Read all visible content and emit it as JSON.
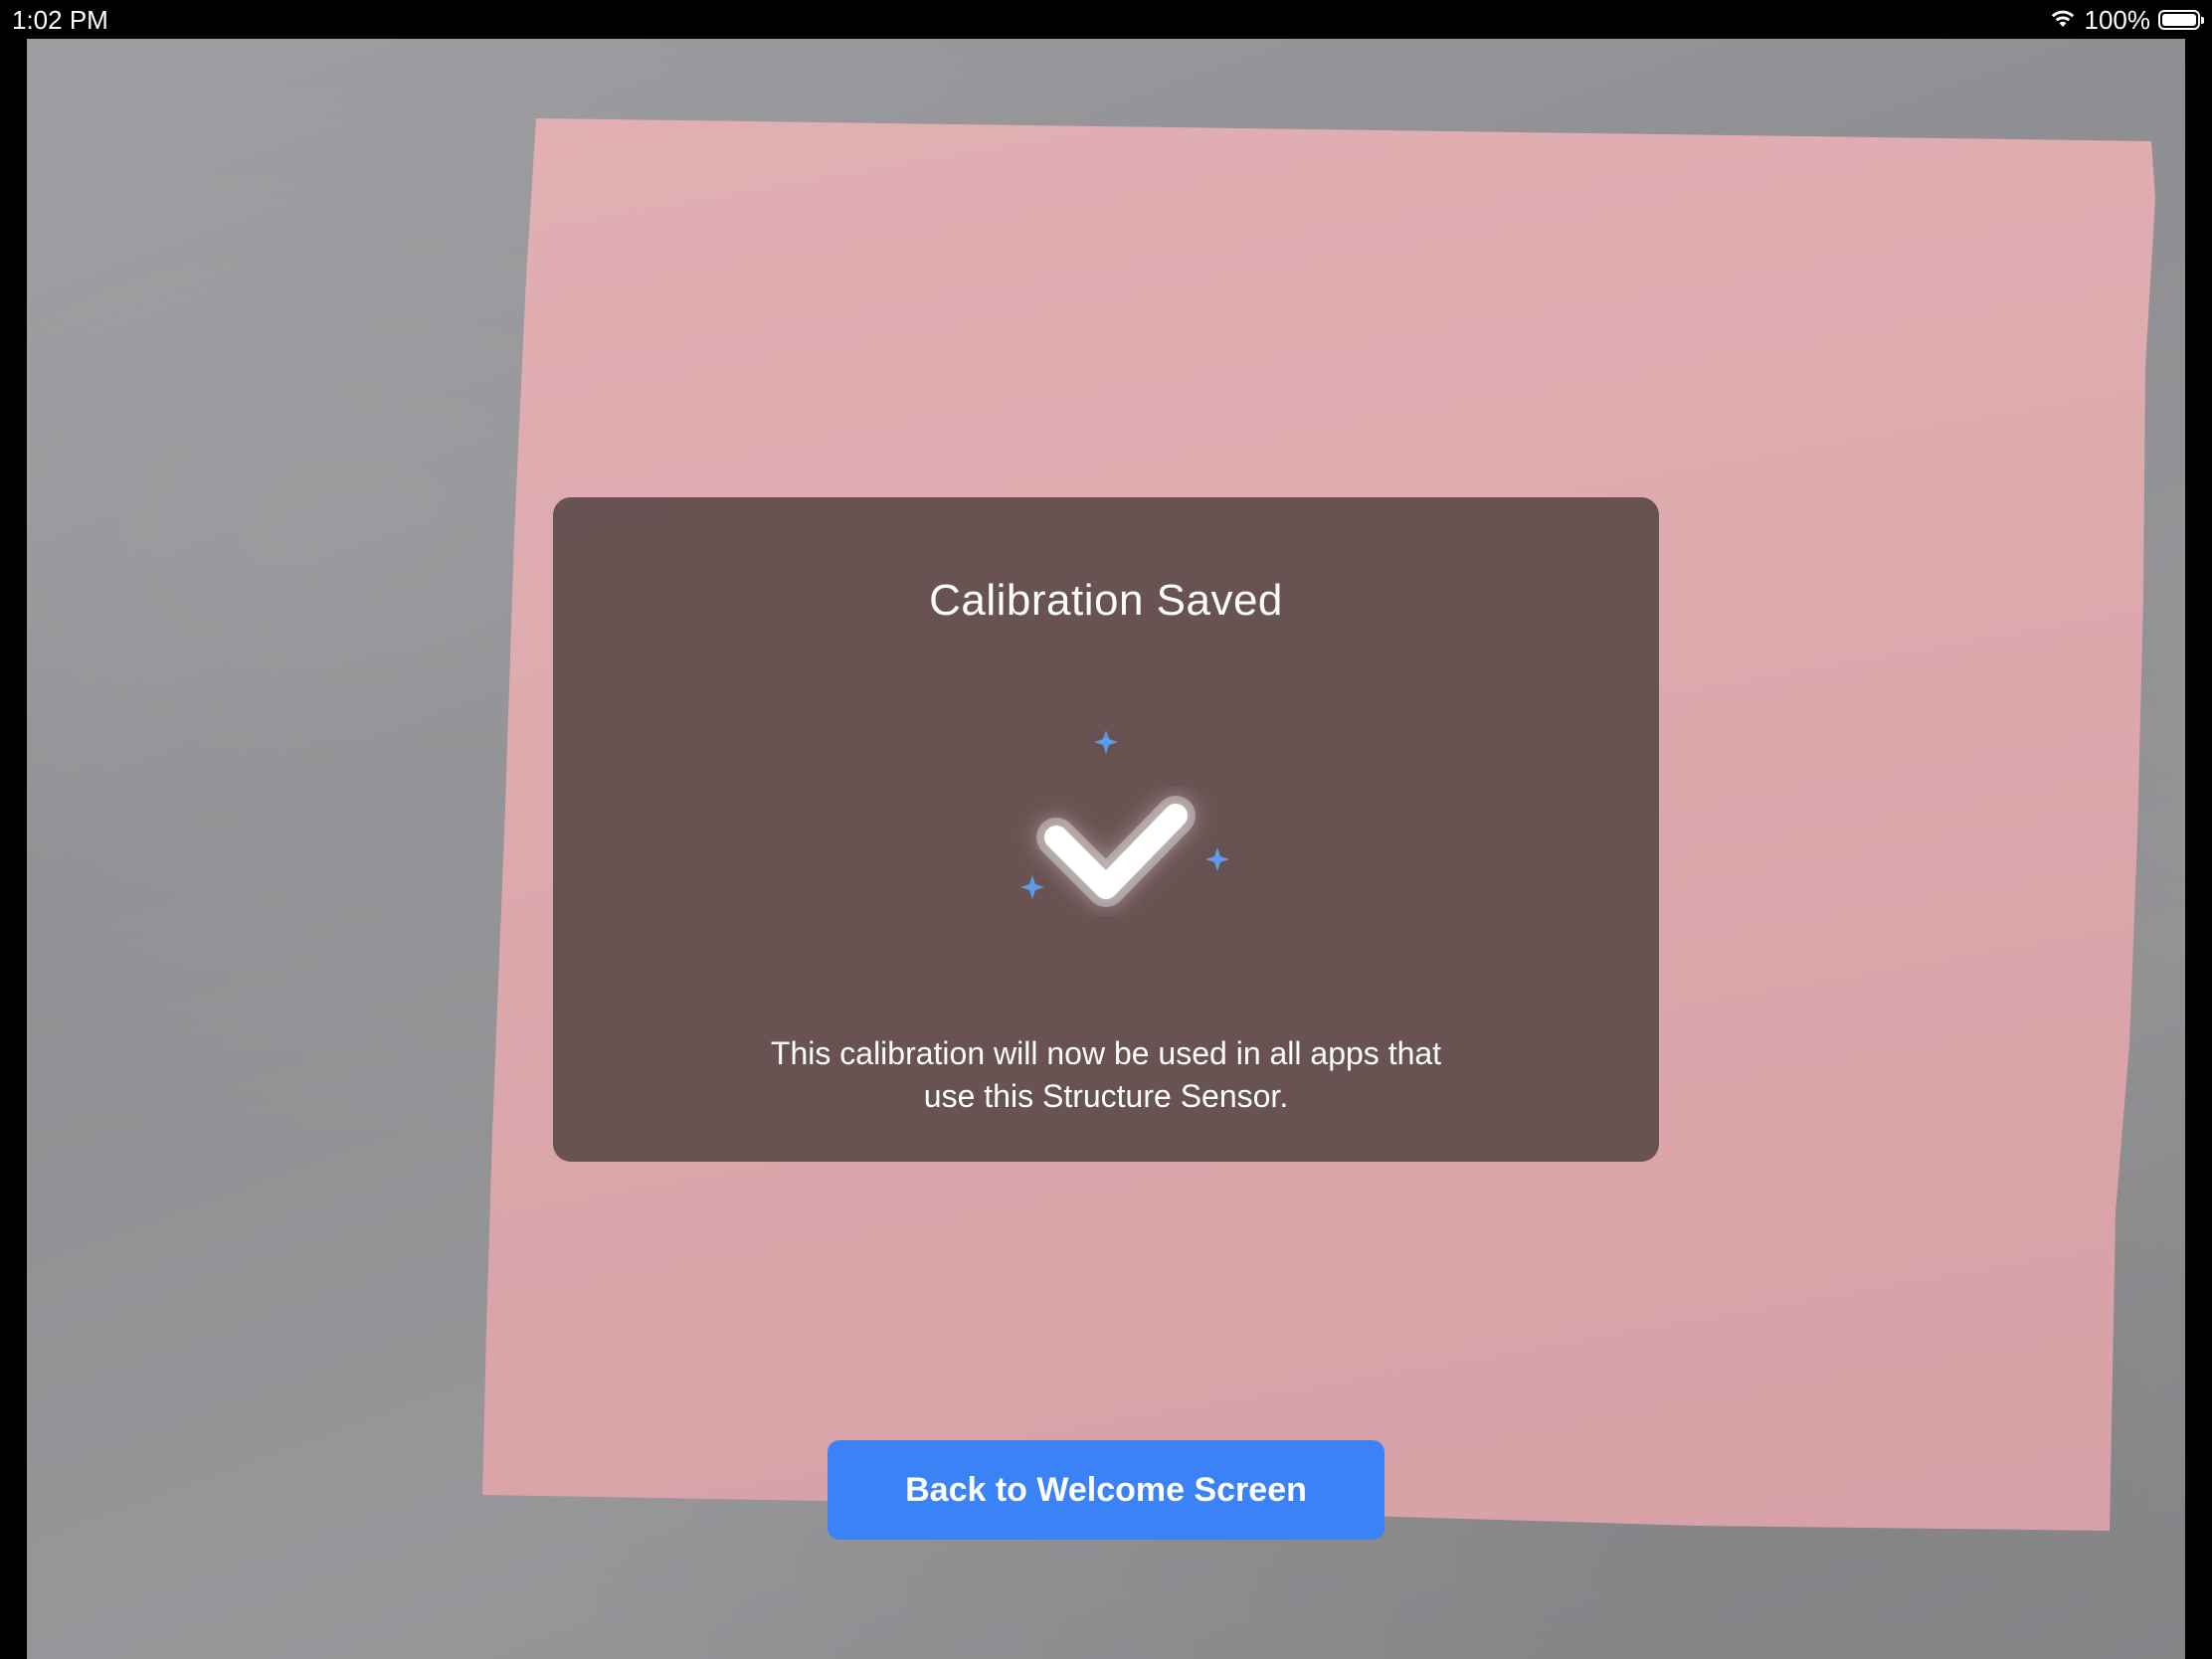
{
  "status_bar": {
    "time": "1:02 PM",
    "battery_percent": "100%",
    "battery_level": 1.0,
    "wifi_icon": "wifi-icon",
    "battery_icon": "battery-icon"
  },
  "dialog": {
    "title": "Calibration Saved",
    "icon": "checkmark-icon",
    "message_line_1": "This calibration will now be used in all apps that",
    "message_line_2": "use this Structure Sensor."
  },
  "back_button": {
    "label": "Back to Welcome Screen"
  },
  "colors": {
    "accent_blue": "#3a82f6",
    "overlay_pink": "#dca9ad",
    "dialog_bg": "#624c4c",
    "sparkle_blue": "#5b9be8"
  }
}
